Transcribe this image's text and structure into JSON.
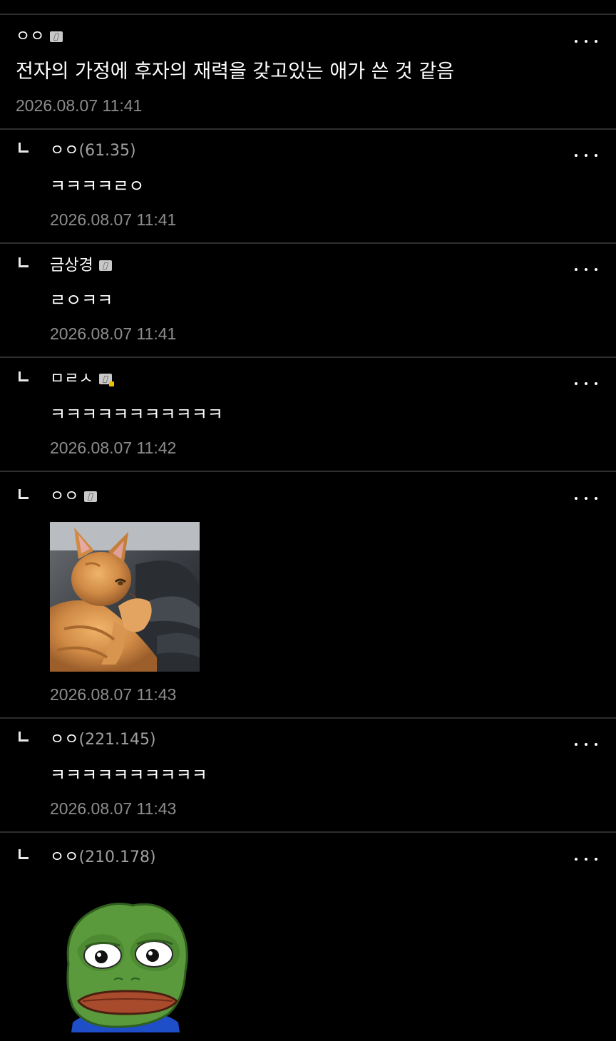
{
  "posts": [
    {
      "author": "ㅇㅇ",
      "ip": "",
      "content": "전자의 가정에 후자의 재력을 갖고있는 애가 쓴 것 같음",
      "date": "2026.08.07 11:41"
    },
    {
      "author": "ㅇㅇ",
      "ip": "(61.35)",
      "content": "ㅋㅋㅋㅋㄹㅇ",
      "date": "2026.08.07 11:41"
    },
    {
      "author": "금상경",
      "ip": "",
      "content": "ㄹㅇㅋㅋ",
      "date": "2026.08.07 11:41"
    },
    {
      "author": "ㅁㄹㅅ",
      "ip": "",
      "content": "ㅋㅋㅋㅋㅋㅋㅋㅋㅋㅋㅋ",
      "date": "2026.08.07 11:42"
    },
    {
      "author": "ㅇㅇ",
      "ip": "",
      "content": "",
      "date": "2026.08.07 11:43"
    },
    {
      "author": "ㅇㅇ",
      "ip": "(221.145)",
      "content": "ㅋㅋㅋㅋㅋㅋㅋㅋㅋㅋ",
      "date": "2026.08.07 11:43"
    },
    {
      "author": "ㅇㅇ",
      "ip": "(210.178)",
      "content": "",
      "date": ""
    }
  ],
  "colors": {
    "background": "#000000",
    "divider": "#2e2e2e",
    "text": "#ffffff",
    "ip": "#a0a0a0",
    "date": "#8d8d8d",
    "badge": "#c8c8c8",
    "badge_gold": "#e6c200"
  },
  "icons": {
    "more": "more-horizontal-icon",
    "reply": "reply-indent-icon",
    "badge": "gallery-member-badge-icon"
  }
}
